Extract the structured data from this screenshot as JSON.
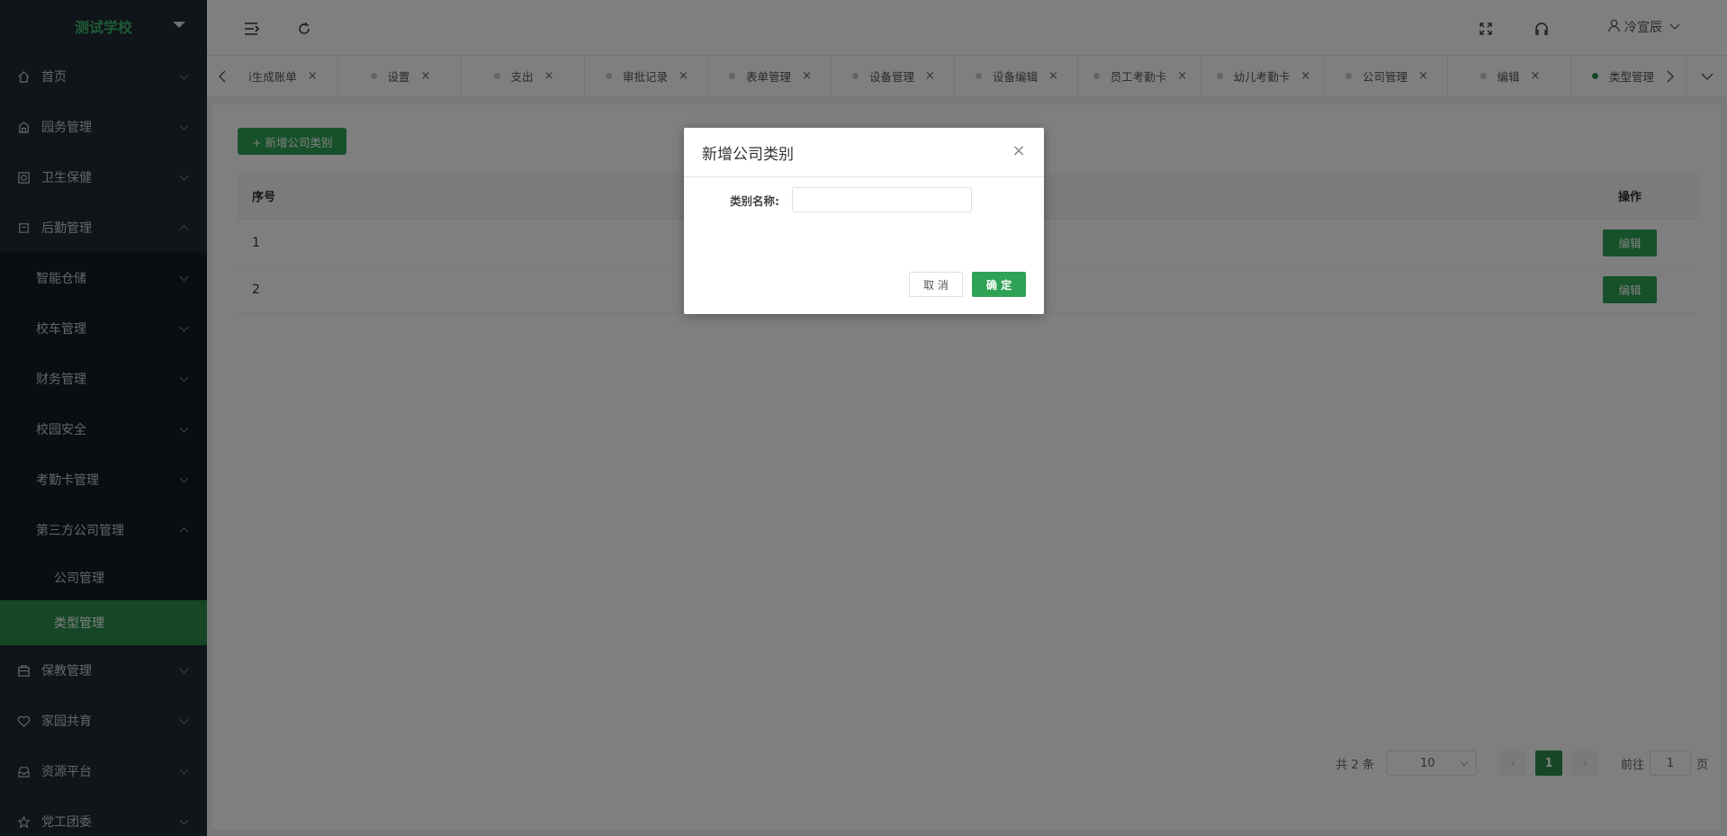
{
  "brand": {
    "title": "测试学校"
  },
  "sidebar": {
    "items": [
      {
        "label": "首页",
        "icon": "home-icon"
      },
      {
        "label": "园务管理",
        "icon": "building-icon"
      },
      {
        "label": "卫生保健",
        "icon": "health-icon"
      },
      {
        "label": "后勤管理",
        "icon": "logistics-icon"
      },
      {
        "label": "智能仓储"
      },
      {
        "label": "校车管理"
      },
      {
        "label": "财务管理"
      },
      {
        "label": "校园安全"
      },
      {
        "label": "考勤卡管理"
      },
      {
        "label": "第三方公司管理"
      },
      {
        "label": "公司管理"
      },
      {
        "label": "类型管理"
      },
      {
        "label": "保教管理",
        "icon": "education-icon"
      },
      {
        "label": "家园共育",
        "icon": "heart-icon"
      },
      {
        "label": "资源平台",
        "icon": "inbox-icon"
      },
      {
        "label": "党工团委",
        "icon": "star-icon"
      }
    ]
  },
  "header": {
    "user": "冷宣辰"
  },
  "tabs": [
    {
      "label": "i生成账单"
    },
    {
      "label": "设置"
    },
    {
      "label": "支出"
    },
    {
      "label": "审批记录"
    },
    {
      "label": "表单管理"
    },
    {
      "label": "设备管理"
    },
    {
      "label": "设备编辑"
    },
    {
      "label": "员工考勤卡"
    },
    {
      "label": "幼儿考勤卡"
    },
    {
      "label": "公司管理"
    },
    {
      "label": "编辑"
    },
    {
      "label": "类型管理"
    }
  ],
  "main": {
    "add_label": "+ 新增公司类别",
    "table": {
      "headers": {
        "index": "序号",
        "op": "操作"
      },
      "rows": [
        {
          "index": "1",
          "edit": "编辑"
        },
        {
          "index": "2",
          "edit": "编辑"
        }
      ]
    },
    "pager": {
      "total": "共 2 条",
      "page_size": "10",
      "current": "1",
      "goto_prefix": "前往",
      "goto_value": "1",
      "goto_suffix": "页"
    }
  },
  "dialog": {
    "title": "新增公司类别",
    "label": "类别名称:",
    "input_value": "",
    "cancel": "取 消",
    "ok": "确 定"
  },
  "colors": {
    "accent": "#2fa355",
    "sidebar_bg": "#1e2a33",
    "active_bg": "#2a8f4d"
  }
}
